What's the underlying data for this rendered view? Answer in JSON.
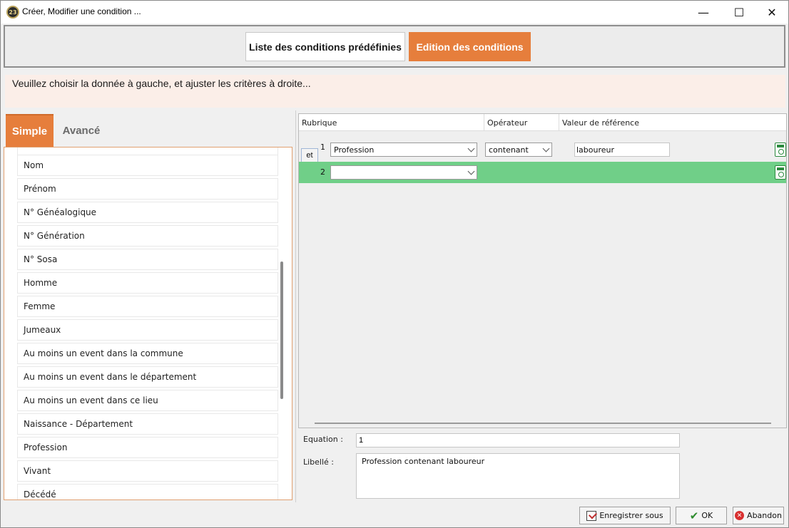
{
  "window": {
    "title": "Créer, Modifier une condition ...",
    "app_icon_text": "23",
    "controls": {
      "minimize": "—",
      "maximize": "☐",
      "close": "✕"
    }
  },
  "top_tabs": [
    {
      "label": "Liste des conditions prédéfinies",
      "active": false
    },
    {
      "label": "Edition des conditions",
      "active": true
    }
  ],
  "instruction": "Veuillez choisir la donnée à gauche, et ajuster les critères à droite...",
  "left_panel": {
    "tabs": [
      {
        "label": "Simple",
        "active": true
      },
      {
        "label": "Avancé",
        "active": false
      }
    ],
    "items": [
      "Nom",
      "Prénom",
      "N° Généalogique",
      "N° Génération",
      "N° Sosa",
      "Homme",
      "Femme",
      "Jumeaux",
      "Au moins un event dans la commune",
      "Au moins un event dans le département",
      "Au moins un event dans ce lieu",
      "Naissance - Département",
      "Profession",
      "Vivant",
      "Décédé"
    ]
  },
  "grid": {
    "columns": [
      "Rubrique",
      "Opérateur",
      "Valeur de référence"
    ],
    "rows": [
      {
        "connector": "et",
        "number": "1",
        "rubrique": "Profession",
        "operateur": "contenant",
        "valeur": "laboureur"
      },
      {
        "connector": "",
        "number": "2",
        "rubrique": "",
        "operateur": "",
        "valeur": ""
      }
    ]
  },
  "equation": {
    "label": "Equation :",
    "value": "1"
  },
  "libelle": {
    "label": "Libellé :",
    "value": "Profession contenant laboureur"
  },
  "buttons": {
    "save_as": "Enregistrer sous",
    "ok": "OK",
    "cancel": "Abandon"
  },
  "colors": {
    "accent": "#e67e3c",
    "selected_row": "#70cf88",
    "instruction_bg": "#fbeee8"
  }
}
